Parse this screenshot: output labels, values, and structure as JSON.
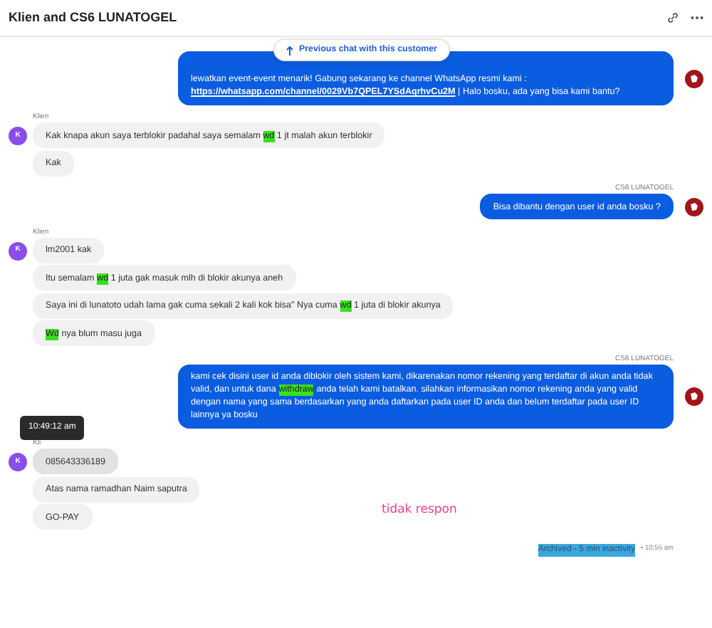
{
  "header": {
    "title": "Klien and CS6 LUNATOGEL"
  },
  "previous_chat_button": {
    "label": "Previous chat with this customer"
  },
  "groups": [
    {
      "kind": "agent",
      "bubbles": [
        {
          "segments": [
            {
              "kind": "text",
              "text": "lewatkan event-event menarik! Gabung sekarang ke channel WhatsApp resmi kami : "
            },
            {
              "kind": "link",
              "text": "https://whatsapp.com/channel/0029Vb7QPEL7YSdAqrhvCu2M"
            },
            {
              "kind": "text",
              "text": " | Halo bosku, ada yang bisa kami bantu?"
            }
          ]
        }
      ]
    },
    {
      "kind": "client",
      "sender": "Klien",
      "avatar": "K",
      "bubbles": [
        {
          "hovered": false,
          "segments": [
            {
              "kind": "text",
              "text": "Kak knapa akun saya terblokir padahal saya semalam "
            },
            {
              "kind": "highlight",
              "text": "wd"
            },
            {
              "kind": "text",
              "text": " 1 jt malah akun terblokir"
            }
          ]
        },
        {
          "hovered": false,
          "segments": [
            {
              "kind": "text",
              "text": "Kak"
            }
          ]
        }
      ]
    },
    {
      "kind": "agent",
      "sender": "CS6 LUNATOGEL",
      "bubbles": [
        {
          "segments": [
            {
              "kind": "text",
              "text": "Bisa dibantu dengan user id anda bosku ?"
            }
          ]
        }
      ]
    },
    {
      "kind": "client",
      "sender": "Klien",
      "avatar": "K",
      "bubbles": [
        {
          "hovered": false,
          "segments": [
            {
              "kind": "text",
              "text": "lm2001 kak"
            }
          ]
        },
        {
          "hovered": false,
          "segments": [
            {
              "kind": "text",
              "text": "Itu semalam "
            },
            {
              "kind": "highlight",
              "text": "wd"
            },
            {
              "kind": "text",
              "text": " 1 juta gak masuk mlh di blokir akunya aneh"
            }
          ]
        },
        {
          "hovered": false,
          "segments": [
            {
              "kind": "text",
              "text": "Saya ini di lunatoto udah lama gak cuma sekali 2 kali kok bisa\" Nya cuma "
            },
            {
              "kind": "highlight",
              "text": "wd"
            },
            {
              "kind": "text",
              "text": " 1 juta di blokir akunya"
            }
          ]
        },
        {
          "hovered": false,
          "segments": [
            {
              "kind": "highlight",
              "text": "Wd"
            },
            {
              "kind": "text",
              "text": " nya blum masu juga"
            }
          ]
        }
      ]
    },
    {
      "kind": "agent",
      "sender": "CS6 LUNATOGEL",
      "bubbles": [
        {
          "segments": [
            {
              "kind": "text",
              "text": "kami cek disini user id anda diblokir oleh sistem kami, dikarenakan nomor rekening yang terdaftar di akun anda tidak valid, dan untuk dana "
            },
            {
              "kind": "highlight",
              "text": "withdraw"
            },
            {
              "kind": "text",
              "text": " anda telah kami batalkan. silahkan informasikan nomor rekening anda yang valid dengan nama yang sama berdasarkan yang anda daftarkan pada user ID anda dan belum terdaftar pada user ID lainnya ya bosku"
            }
          ]
        }
      ]
    },
    {
      "kind": "client",
      "sender": "Kli",
      "avatar": "K",
      "bubbles": [
        {
          "hovered": true,
          "tooltip": "10:49:12 am",
          "segments": [
            {
              "kind": "text",
              "text": "085643336189"
            }
          ]
        },
        {
          "hovered": false,
          "segments": [
            {
              "kind": "text",
              "text": "Atas nama ramadhan Naim saputra"
            }
          ]
        },
        {
          "hovered": false,
          "segments": [
            {
              "kind": "text",
              "text": "GO-PAY"
            }
          ]
        }
      ]
    }
  ],
  "annotation": "tidak respon",
  "status": {
    "text": "Archived - 5 min inactivity",
    "selected": true,
    "time": "• 10:55 am"
  }
}
